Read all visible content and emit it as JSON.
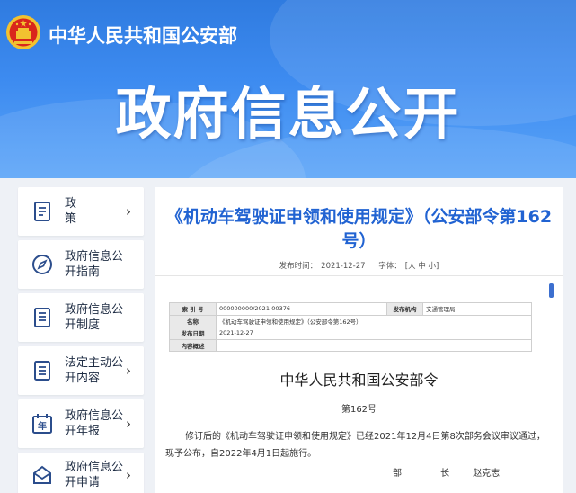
{
  "header": {
    "ministry": "中华人民共和国公安部",
    "banner_title": "政府信息公开",
    "colors": {
      "banner_top": "#2f7be0",
      "banner_bottom": "#5aa4f8",
      "emblem_red": "#d9261c",
      "emblem_gold": "#f2c230"
    }
  },
  "sidebar": {
    "items": [
      {
        "label": "政 策",
        "icon": "document-list-icon",
        "chevron": "›"
      },
      {
        "label": "政府信息公开指南",
        "icon": "compass-icon",
        "chevron": ""
      },
      {
        "label": "政府信息公开制度",
        "icon": "document-list-icon",
        "chevron": ""
      },
      {
        "label": "法定主动公开内容",
        "icon": "document-list-icon",
        "chevron": "›"
      },
      {
        "label": "政府信息公开年报",
        "icon": "calendar-year-icon",
        "chevron": "›"
      },
      {
        "label": "政府信息公开申请",
        "icon": "mail-icon",
        "chevron": "›"
      }
    ]
  },
  "main": {
    "title": "《机动车驾驶证申领和使用规定》（公安部令第162号）",
    "meta": {
      "published_label": "发布时间：",
      "published_value": "2021-12-27",
      "font_label": "字体：",
      "font_options": "[大 中 小]"
    },
    "info_table": {
      "rows": [
        {
          "k1": "索 引 号",
          "v1": "000000000/2021-00376",
          "k2": "发布机构",
          "v2": "交通管理局"
        },
        {
          "k1": "名称",
          "v1": "《机动车驾驶证申领和使用规定》（公安部令第162号）"
        },
        {
          "k1": "发布日期",
          "v1": "2021-12-27"
        },
        {
          "k1": "内容概述",
          "v1": ""
        }
      ]
    },
    "order_title": "中华人民共和国公安部令",
    "order_number": "第162号",
    "body": "修订后的《机动车驾驶证申领和使用规定》已经2021年12月4日第8次部务会议审议通过，现予公布，自2022年4月1日起施行。",
    "signature": {
      "role": "部 长",
      "name": "赵克志"
    }
  }
}
